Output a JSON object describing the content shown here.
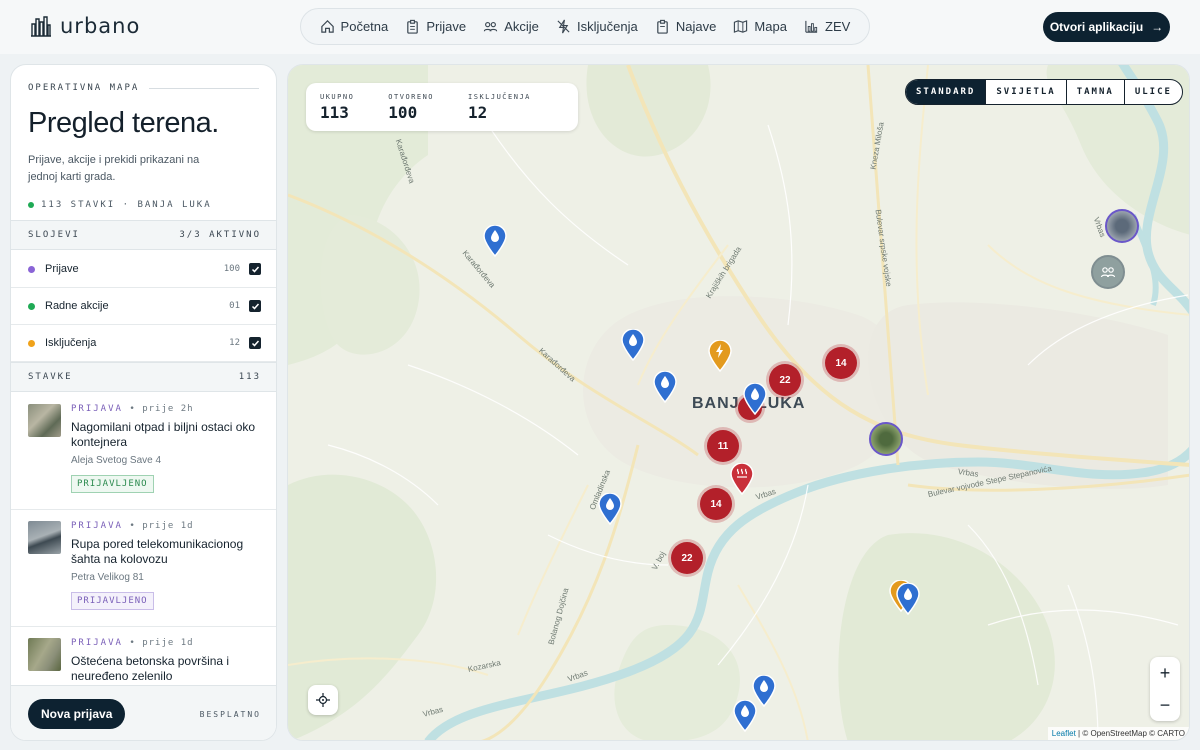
{
  "header": {
    "brand": "urbano",
    "nav": [
      {
        "label": "Početna",
        "icon": "home-icon"
      },
      {
        "label": "Prijave",
        "icon": "clipboard-icon"
      },
      {
        "label": "Akcije",
        "icon": "people-icon"
      },
      {
        "label": "Isključenja",
        "icon": "power-off-icon"
      },
      {
        "label": "Najave",
        "icon": "clipboard-icon"
      },
      {
        "label": "Mapa",
        "icon": "map-icon"
      },
      {
        "label": "ZEV",
        "icon": "chart-icon"
      }
    ],
    "cta_label": "Otvori aplikaciju",
    "cta_arrow": "→"
  },
  "sidebar": {
    "eyebrow": "OPERATIVNA MAPA",
    "title": "Pregled terena.",
    "description": "Prijave, akcije i prekidi prikazani na jednoj karti grada.",
    "meta": "113 STAVKI · BANJA LUKA",
    "layers_label": "SLOJEVI",
    "layers_active": "3/3 AKTIVNO",
    "layers": [
      {
        "label": "Prijave",
        "count": "100",
        "color": "#8a64d6"
      },
      {
        "label": "Radne akcije",
        "count": "01",
        "color": "#1faa55"
      },
      {
        "label": "Isključenja",
        "count": "12",
        "color": "#f0a21a"
      }
    ],
    "items_label": "STAVKE",
    "items_count": "113",
    "items": [
      {
        "type": "PRIJAVA",
        "time": "• prije 2h",
        "title": "Nagomilani otpad i biljni ostaci oko kontejnera",
        "address": "Aleja Svetog Save 4",
        "badge": "PRIJAVLJENO",
        "badge_color": "#2b8a4e"
      },
      {
        "type": "PRIJAVA",
        "time": "• prije 1d",
        "title": "Rupa pored telekomunikacionog šahta na kolovozu",
        "address": "Petra Velikog 81",
        "badge": "PRIJAVLJENO",
        "badge_color": "#7a5fb8"
      },
      {
        "type": "PRIJAVA",
        "time": "• prije 1d",
        "title": "Oštećena betonska površina i neuređeno zelenilo",
        "address": "",
        "badge": "",
        "badge_color": "#7a5fb8"
      }
    ],
    "new_button": "Nova prijava",
    "footer_note": "BESPLATNO"
  },
  "map": {
    "stats": [
      {
        "label": "UKUPNO",
        "value": "113"
      },
      {
        "label": "OTVORENO",
        "value": "100"
      },
      {
        "label": "ISKLJUČENJA",
        "value": "12"
      }
    ],
    "styles": [
      {
        "label": "STANDARD",
        "active": true
      },
      {
        "label": "SVIJETLA",
        "active": false
      },
      {
        "label": "TAMNA",
        "active": false
      },
      {
        "label": "ULICE",
        "active": false
      }
    ],
    "city_label": "BANJA LUKA",
    "streets": [
      "Karađorđeva",
      "Karađorđeva",
      "Karađorđeva",
      "Krajiških brigada",
      "Kralja Petra I",
      "Kneza Miloša",
      "Bulevar srpske vojske",
      "Omladinska",
      "Bulevar vojvode Stepe Stepanovića",
      "Vrbas",
      "Vrbas",
      "Vrbas",
      "Vrbas",
      "Vrbas",
      "Kozarska",
      "Bolanog Dojčina",
      "V. boj"
    ],
    "clusters": [
      "22",
      "14",
      "11",
      "14",
      "22"
    ],
    "zoom_in": "+",
    "zoom_out": "−",
    "attribution_leaflet": "Leaflet",
    "attribution_rest": "| © OpenStreetMap © CARTO"
  },
  "colors": {
    "accent_dark": "#0d2231",
    "cluster_red": "#b3202a",
    "pin_blue": "#2f6fd1",
    "pin_orange": "#e39a1e",
    "river": "#bfe0e2"
  }
}
